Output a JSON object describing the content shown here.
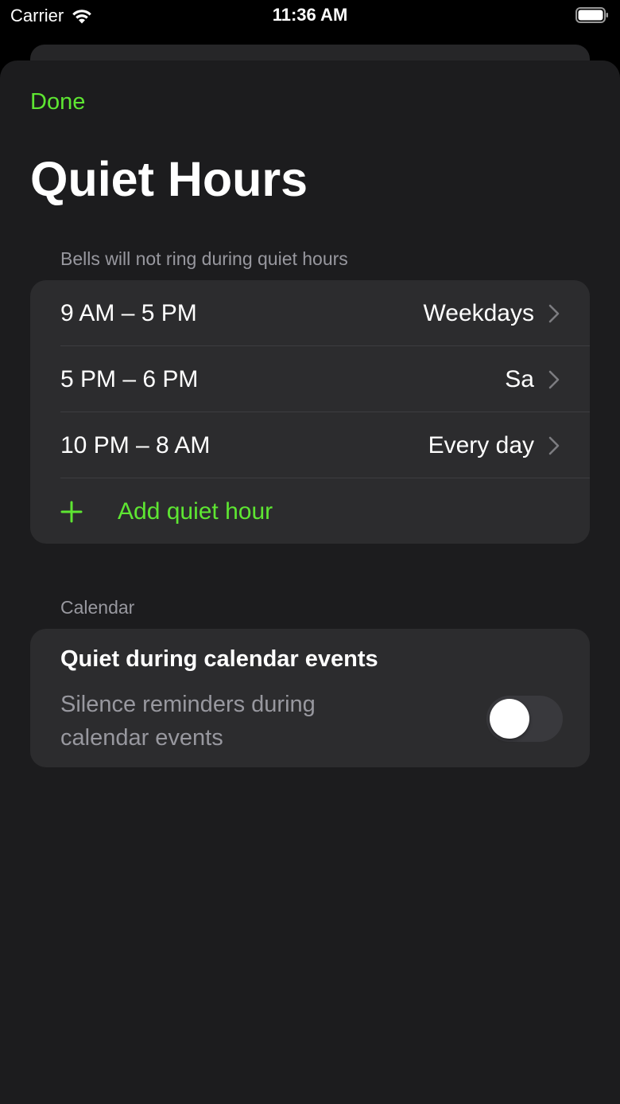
{
  "status_bar": {
    "carrier": "Carrier",
    "time": "11:36 AM"
  },
  "header": {
    "done_label": "Done",
    "title": "Quiet Hours"
  },
  "quiet_hours": {
    "section_header": "Bells will not ring during quiet hours",
    "items": [
      {
        "time": "9 AM – 5 PM",
        "days": "Weekdays"
      },
      {
        "time": "5 PM – 6 PM",
        "days": "Sa"
      },
      {
        "time": "10 PM – 8 AM",
        "days": "Every day"
      }
    ],
    "add_label": "Add quiet hour"
  },
  "calendar": {
    "section_header": "Calendar",
    "title": "Quiet during calendar events",
    "subtitle": "Silence reminders during calendar events",
    "toggle_on": false
  },
  "colors": {
    "accent": "#5ee632",
    "background": "#1c1c1e",
    "group": "#2c2c2e",
    "secondary_text": "#98989f"
  }
}
